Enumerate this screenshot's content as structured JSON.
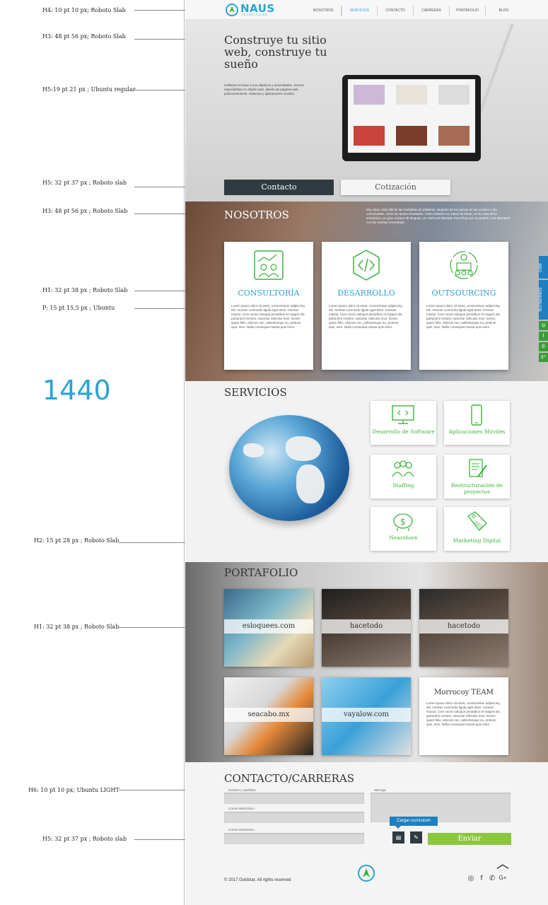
{
  "annotations": {
    "header_font": "H4: 10 pt 10 px; Roboto Slab",
    "hero_title_font": "H3: 48 pt 56 px; Roboto Slab",
    "hero_sub_font": "H5:19 pt 21 px ; Ubuntu regular",
    "button_font": "H5: 32 pt 37 px ; Roboto slab",
    "section_title_font": "H3: 48 pt 56 px ; Roboto Slab",
    "card_title_font": "H1: 32 pt 38 px ; Roboto Slab",
    "paragraph_font": "P: 15 pt 15,5 px ; Ubuntu",
    "breakpoint": "1440",
    "service_label_font": "H2: 15 pt 28 px ; Roboto Slab",
    "portfolio_font": "H1: 32 pt 38 px ; Roboto Slab",
    "form_label_font": "H6: 10 pt 10 px; Ubuntu LIGHT",
    "send_button_font": "H5: 32 pt 37 px ; Roboto slab"
  },
  "header": {
    "logo_text": "NAUS",
    "logo_sub": "TECNOLOGÍAS",
    "nav": [
      "NOSOTROS",
      "SERVICIOS",
      "CONTACTO",
      "CARRERAS",
      "PORTAFOLIO",
      "BLOG"
    ],
    "active_index": 1
  },
  "hero": {
    "title": "Construye tu sitio web, construye tu sueño",
    "subtitle": "Software en base a sus objetivos y necesidades. Somos especialistas en diseño web, diseño de páginas web , posicionamiento, sistemas y aplicaciones moviles.",
    "contact_button": "Contacto",
    "quote_button": "Cotización"
  },
  "nosotros": {
    "title": "NOSOTROS",
    "text": "Muy lejos, más allá de las montañas de palabras, alejados de los países de las vocales y las consonantes, viven los textos simulados. Viven aislados en casas de letras, en la costa de la semántica, un gran océano de lenguas. Un riachuelo llamado Pons fluye por su pueblo y los abastece con las normas necesarias.",
    "cards": [
      {
        "title": "CONSULTORÍA",
        "icon": "consulting-people-icon",
        "body": "Lorem ipsum dolor sit amet, consectetuer adipiscing elit. Aenean commodo ligula eget dolor. Aenean massa. Cum sociis natoque penatibus et magnis dis parturient montes, nascetur ridiculus mus. Donec quam felis, ultricies nec, pellentesque eu, pretium quis, sem. Nulla consequat massa quis enim."
      },
      {
        "title": "DESARROLLO",
        "icon": "code-hexagon-icon",
        "body": "Lorem ipsum dolor sit amet, consectetuer adipiscing elit. Aenean commodo ligula eget dolor. Aenean massa. Cum sociis natoque penatibus et magnis dis parturient montes, nascetur ridiculus mus. Donec quam felis, ultricies nec, pellentesque eu, pretium quis, sem. Nulla consequat massa quis enim."
      },
      {
        "title": "OUTSOURCING",
        "icon": "team-cycle-icon",
        "body": "Lorem ipsum dolor sit amet, consectetuer adipiscing elit. Aenean commodo ligula eget dolor. Aenean massa. Cum sociis natoque penatibus et magnis dis parturient montes, nascetur ridiculus mus. Donec quam felis, ultricies nec, pellentesque eu, pretium quis, sem. Nulla consequat massa quis enim."
      }
    ]
  },
  "side_tabs": {
    "chat": "CHAT",
    "testimonials": "TESTIMONIOS",
    "icons": [
      "instagram-icon",
      "facebook-icon",
      "whatsapp-icon",
      "google-plus-icon"
    ],
    "icon_glyphs": [
      "◎",
      "f",
      "✆",
      "g+"
    ]
  },
  "servicios": {
    "title": "SERVICIOS",
    "items": [
      {
        "label": "Desarrollo de Software",
        "icon": "monitor-code-icon"
      },
      {
        "label": "Aplicaciones Móviles",
        "icon": "smartphone-icon"
      },
      {
        "label": "Staffing",
        "icon": "people-group-icon"
      },
      {
        "label": "Restructuración de proyectos",
        "icon": "document-edit-icon"
      },
      {
        "label": "Nearshore",
        "icon": "piggy-bank-icon"
      },
      {
        "label": "Marketing Digital",
        "icon": "seo-tag-icon"
      }
    ]
  },
  "portafolio": {
    "title": "PORTAFOLIO",
    "items": [
      "esloquees.com",
      "hacetodo",
      "hacetodo",
      "seacabo.mx",
      "vayalow.com"
    ],
    "team_title": "Morrocoy TEAM",
    "team_body": "Lorem ipsum dolor sit amet, consectetuer adipiscing elit. Aenean commodo ligula eget dolor. Aenean massa. Cum sociis natoque penatibus et magnis dis parturient montes, nascetur ridiculus mus. Donec quam felis, ultricies nec, pellentesque eu, pretium quis, sem. Nulla consequat massa quis enim."
  },
  "contacto": {
    "title": "CONTACTO/CARRERAS",
    "name_label": "Nombre y Apellidos",
    "email_label": "Correo electrónico",
    "email_label_2": "Correo electrónico",
    "message_label": "Mensaje",
    "upload_tooltip": "Cargar curriculum",
    "send_button": "Enviar"
  },
  "footer": {
    "copyright": "© 2017 Goldstar, All rights reserved"
  },
  "colors": {
    "accent_blue": "#2aa3d8",
    "accent_green": "#3cb43c",
    "send_green": "#8cc63f",
    "dark": "#2f3b40"
  }
}
